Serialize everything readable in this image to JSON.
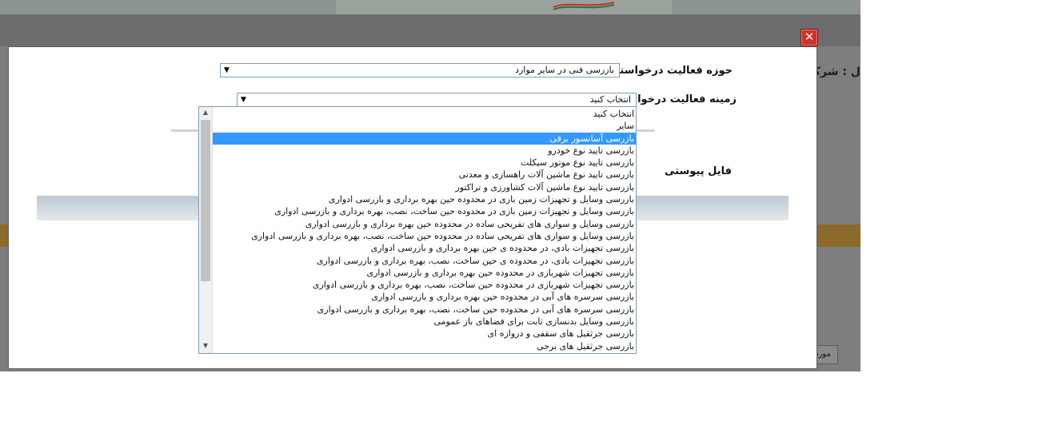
{
  "background": {
    "company_label": "ل : شرکت",
    "more_button_label": "مورد"
  },
  "modal": {
    "close_icon": "close-icon",
    "activity_area": {
      "label": "حوزه فعالیت درخواستی*:",
      "value": "بازرسی فنی در سایر موارد"
    },
    "activity_field": {
      "label": "زمینه فعالیت درخواستی :",
      "value": "انتخاب کنید"
    },
    "attachment_label": "فایل پیوستی"
  },
  "dropdown": {
    "selected_index": 2,
    "options": [
      "انتخاب کنید",
      "سایر",
      "بازرسی آسانسور برقی",
      "بازرسی تایید نوع خودرو",
      "بازرسی تایید نوع موتور سیکلت",
      "بازرسی تایید نوع ماشین آلات راهسازی و معدنی",
      "بازرسی تایید نوع ماشین آلات کشاورزی و تراکتور",
      "بازرسی وسایل و تجهیزات زمین بازی در محدوده حین بهره برداری و بازرسی ادواری",
      "بازرسی وسایل و تجهیزات زمین بازی در محدوده حین ساخت، نصب، بهره برداری و بازرسی ادواری",
      "بازرسی وسایل و سواری های تفریحی ساده در محدوده حین بهره برداری و بازرسی ادواری",
      "بازرسی وسایل و سواری های تفریحی ساده در محدوده حین ساخت، نصب، بهره برداری و بازرسی ادواری",
      "بازرسی تجهیزات بادی، در محدوده ی حین بهره برداری و بازرسی ادواری",
      "بازرسی تجهیزات بادی، در محدوده ی حین ساخت، نصب، بهره برداری و بازرسی ادواری",
      "بازرسی تجهیزات شهربازی در محدوده حین بهره برداری و بازرسی ادواری",
      "بازرسی تجهیزات شهربازی در محدوده حین ساخت، نصب، بهره برداری و بازرسی ادواری",
      "بازرسی سرسره های آبی در محدوده حین بهره برداری و بازرسی ادواری",
      "بازرسی سرسره های آبی در محدوده حین ساخت، نصب، بهره برداری و بازرسی ادواری",
      "بازرسی وسایل بدنسازی ثابت برای فضاهای باز عمومی",
      "بازرسی جرثقیل های سقفی و دروازه ای",
      "بازرسی جرثقیل های برجی"
    ]
  },
  "colors": {
    "selection": "#3399ff",
    "close_button": "#d2312a",
    "overlay": "#7d7d7d"
  }
}
